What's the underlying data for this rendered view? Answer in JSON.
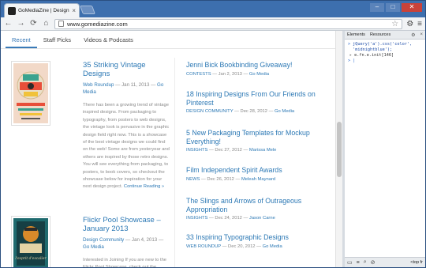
{
  "browser": {
    "tab_title": "GoMediaZine | Design insight",
    "tab_close": "×",
    "url": "www.gomediazine.com",
    "window_controls": {
      "min": "–",
      "max": "□",
      "close": "✕"
    },
    "icons": {
      "back": "←",
      "forward": "→",
      "reload": "⟳",
      "home": "⌂",
      "star": "☆",
      "page_action": "⚙",
      "menu": "≡"
    }
  },
  "site": {
    "tabs": [
      "Recent",
      "Staff Picks",
      "Videos & Podcasts"
    ],
    "active_tab": 0
  },
  "featured": [
    {
      "title": "35 Striking Vintage Designs",
      "category": "Web Roundup",
      "date": " — Jan 11, 2013 — ",
      "author": "Go Media",
      "excerpt": "There has been a growing trend of vintage inspired designs. From packaging to typography, from posters to web designs, the vintage look is pervasive in the graphic design field right now. This is a showcase of the best vintage designs we could find on the web! Some are from yesteryear and others are inspired by those retro designs. You will see everything from packaging, to posters, to book covers, so checkout the showcase below for inspiration for your next design project. ",
      "more": "Continue Reading »"
    },
    {
      "title": "Flickr Pool Showcase – January 2013",
      "category": "Design Community",
      "date": " — Jan 4, 2013 — ",
      "author": "Go Media",
      "excerpt": "Interested in Joining If you are new to the Flickr Pool Showcase, check out the",
      "more": ""
    }
  ],
  "thumb2_text": "l'esprit d'escalier",
  "recent": [
    {
      "title": "Jenni Bick Bookbinding Giveaway!",
      "category": "CONTESTS",
      "date": " — Jan 2, 2013 — ",
      "author": "Go Media"
    },
    {
      "title": "18 Inspiring Designs From Our Friends on Pinterest",
      "category": "DESIGN COMMUNITY",
      "date": " — Dec 28, 2012 — ",
      "author": "Go Media"
    },
    {
      "title": "5 New Packaging Templates for Mockup Everything!",
      "category": "INSIGHTS",
      "date": " — Dec 27, 2012 — ",
      "author": "Marissa Mele"
    },
    {
      "title": "Film Independent Spirit Awards",
      "category": "NEWS",
      "date": " — Dec 26, 2012 — ",
      "author": "Meleah Maynard"
    },
    {
      "title": "The Slings and Arrows of Outrageous Appropriation",
      "category": "INSIGHTS",
      "date": " — Dec 24, 2012 — ",
      "author": "Jason Carne"
    },
    {
      "title": "33 Inspiring Typographic Designs",
      "category": "WEB ROUNDUP",
      "date": " — Dec 20, 2012 — ",
      "author": "Go Media"
    }
  ],
  "devtools": {
    "tabs": [
      "Elements",
      "Resources"
    ],
    "console_input": "jQuery('a').css('color', 'midnightblue');",
    "console_output": "e.fn.e.init[146]",
    "prompt": ">",
    "frame_select": "<top fr",
    "icons": {
      "settings": "⚙",
      "close": "×",
      "dock": "▭",
      "console": "≡",
      "search": "⌕",
      "clear": "⊘"
    }
  }
}
